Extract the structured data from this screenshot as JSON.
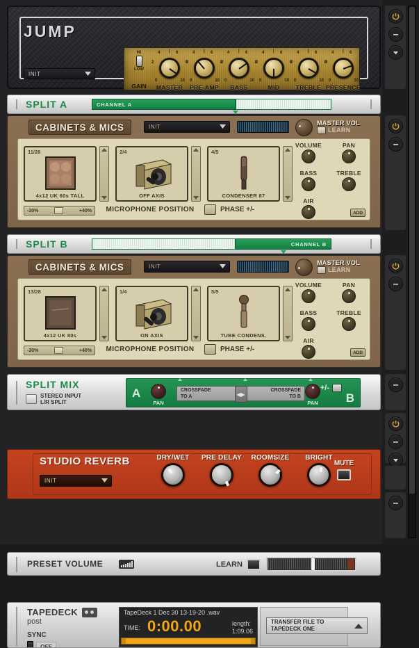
{
  "amp": {
    "name": "JUMP",
    "preset": "INIT",
    "gain_switch": {
      "top": "HI",
      "bottom": "LOW",
      "label": "GAIN"
    },
    "knobs": [
      {
        "label": "MASTER",
        "min": "0",
        "max": "10",
        "scale": [
          "2",
          "4",
          "6",
          "8"
        ],
        "angle": 35
      },
      {
        "label": "PRE-AMP",
        "min": "0",
        "max": "10",
        "scale": [
          "2",
          "4",
          "6",
          "8"
        ],
        "angle": -130
      },
      {
        "label": "BASS",
        "min": "0",
        "max": "10",
        "scale": [
          "2",
          "4",
          "6",
          "8"
        ],
        "angle": -35
      },
      {
        "label": "MID",
        "min": "0",
        "max": "10",
        "scale": [
          "2",
          "4",
          "6",
          "8"
        ],
        "angle": 90
      },
      {
        "label": "TREBLE",
        "min": "0",
        "max": "10",
        "scale": [
          "2",
          "4",
          "6",
          "8"
        ],
        "angle": 30
      },
      {
        "label": "PRESENCE",
        "min": "0",
        "max": "10",
        "scale": [
          "2",
          "4",
          "6",
          "8"
        ],
        "angle": -20
      }
    ]
  },
  "split_a": {
    "title": "SPLIT A",
    "channel_label": "CHANNEL A",
    "fill_percent": 60
  },
  "split_b": {
    "title": "SPLIT B",
    "channel_label": "CHANNEL B",
    "fill_percent": 40
  },
  "cab_a": {
    "title": "CABINETS & MICS",
    "preset": "INIT",
    "master_vol_label": "MASTER VOL",
    "learn_label": "LEARN",
    "cabinet": {
      "index": "11/28",
      "name": "4x12 UK 60s TALL"
    },
    "mic_position": {
      "index": "2/4",
      "name": "OFF AXIS"
    },
    "mic": {
      "index": "4/5",
      "name": "CONDENSER 87"
    },
    "position_min": "-30%",
    "position_max": "+40%",
    "mic_position_label": "MICROPHONE POSITION",
    "phase_label": "PHASE +/-",
    "knobs": [
      "VOLUME",
      "PAN",
      "BASS",
      "TREBLE",
      "AIR"
    ],
    "add_label": "ADD"
  },
  "cab_b": {
    "title": "CABINETS & MICS",
    "preset": "INIT",
    "master_vol_label": "MASTER VOL",
    "learn_label": "LEARN",
    "cabinet": {
      "index": "13/28",
      "name": "4x12 UK 80s"
    },
    "mic_position": {
      "index": "1/4",
      "name": "ON AXIS"
    },
    "mic": {
      "index": "5/5",
      "name": "TUBE CONDENS."
    },
    "position_min": "-30%",
    "position_max": "+40%",
    "mic_position_label": "MICROPHONE POSITION",
    "phase_label": "PHASE +/-",
    "knobs": [
      "VOLUME",
      "PAN",
      "BASS",
      "TREBLE",
      "AIR"
    ],
    "add_label": "ADD"
  },
  "split_mix": {
    "title": "SPLIT MIX",
    "stereo_line1": "STEREO INPUT",
    "stereo_line2": "L/R SPLIT",
    "a_label": "A",
    "b_label": "B",
    "pan_a_label": "PAN",
    "pan_b_label": "PAN",
    "crossfade_a_line1": "CROSSFADE",
    "crossfade_a_line2": "TO A",
    "crossfade_b_line1": "CROSSFADE",
    "crossfade_b_line2": "TO B",
    "plus_minus": "+/-"
  },
  "reverb": {
    "title": "STUDIO REVERB",
    "preset": "INIT",
    "knobs": [
      {
        "label": "DRY/WET",
        "angle": -40
      },
      {
        "label": "PRE DELAY",
        "angle": 155
      },
      {
        "label": "ROOMSIZE",
        "angle": 50
      },
      {
        "label": "BRIGHT",
        "angle": 0
      }
    ],
    "mute_label": "MUTE"
  },
  "preset_volume": {
    "title": "PRESET VOLUME",
    "learn_label": "LEARN",
    "slider_position_percent": 50
  },
  "tapedeck": {
    "title": "TAPEDECK",
    "subtitle": "post",
    "sync_label": "SYNC",
    "sync_state": "OFF",
    "filename": "TapeDeck 1  Dec 30 13-19-20 .wav",
    "time_label": "TIME:",
    "time_value": "0:00.00",
    "length_label": "length:",
    "length_value": "1:09.06",
    "transfer_line1": "TRANSFER FILE TO",
    "transfer_line2": "TAPEDECK ONE"
  },
  "colors": {
    "green": "#178a4a",
    "amber": "#f2a617",
    "reverb_red": "#c4431f",
    "power_gold": "#d8a23a"
  }
}
